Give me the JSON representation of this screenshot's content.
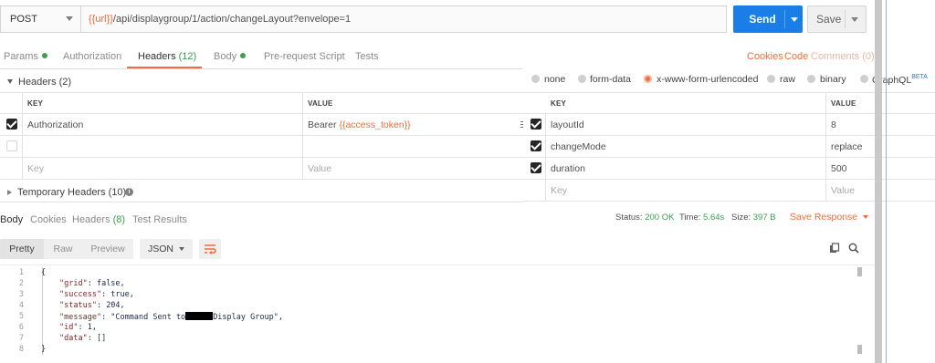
{
  "request": {
    "method": "POST",
    "url_var": "{{url}}",
    "url_path": "/api/displaygroup/1/action/changeLayout?envelope=1",
    "send_label": "Send",
    "save_label": "Save"
  },
  "tabs": [
    {
      "label": "Params"
    },
    {
      "label": "Authorization"
    },
    {
      "label": "Headers",
      "count": "(12)"
    },
    {
      "label": "Body"
    },
    {
      "label": "Pre-request Script"
    },
    {
      "label": "Tests"
    }
  ],
  "right_links": {
    "cookies": "Cookies",
    "code": "Code",
    "comments": "Comments (0)"
  },
  "headers_section": {
    "title": "Headers (2)",
    "col_key": "KEY",
    "col_value": "VALUE",
    "rows": [
      {
        "key": "Authorization",
        "value_prefix": "Bearer ",
        "value_var": "{{access_token}}",
        "checked": true
      }
    ],
    "key_placeholder": "Key",
    "value_placeholder": "Value",
    "temp_title": "Temporary Headers (10)",
    "info_icon": "i"
  },
  "body_types": [
    {
      "label": "none"
    },
    {
      "label": "form-data"
    },
    {
      "label": "x-www-form-urlencoded",
      "selected": true
    },
    {
      "label": "raw"
    },
    {
      "label": "binary"
    },
    {
      "label": "GraphQL",
      "badge": "BETA"
    }
  ],
  "body_table": {
    "col_key": "KEY",
    "col_value": "VALUE",
    "rows": [
      {
        "key": "layoutId",
        "value": "8"
      },
      {
        "key": "changeMode",
        "value": "replace"
      },
      {
        "key": "duration",
        "value": "500"
      }
    ],
    "key_placeholder": "Key",
    "value_placeholder": "Value"
  },
  "response_tabs": [
    {
      "label": "Body"
    },
    {
      "label": "Cookies"
    },
    {
      "label": "Headers",
      "count": "(8)"
    },
    {
      "label": "Test Results"
    }
  ],
  "response_meta": {
    "status_label": "Status:",
    "status_value": "200 OK",
    "time_label": "Time:",
    "time_value": "5.64s",
    "size_label": "Size:",
    "size_value": "397 B",
    "save_response": "Save Response"
  },
  "view_modes": [
    "Pretty",
    "Raw",
    "Preview"
  ],
  "format": "JSON",
  "code_lines": [
    {
      "n": "1",
      "text": "{"
    },
    {
      "n": "2",
      "key": "\"grid\"",
      "rest": ": false,"
    },
    {
      "n": "3",
      "key": "\"success\"",
      "rest": ": true,"
    },
    {
      "n": "4",
      "key": "\"status\"",
      "rest": ": 204,"
    },
    {
      "n": "5",
      "key": "\"message\"",
      "rest_a": ": \"Command Sent to",
      "rest_b": "Display Group\","
    },
    {
      "n": "6",
      "key": "\"id\"",
      "rest": ": 1,"
    },
    {
      "n": "7",
      "key": "\"data\"",
      "rest": ": []"
    },
    {
      "n": "8",
      "text": "}"
    }
  ]
}
